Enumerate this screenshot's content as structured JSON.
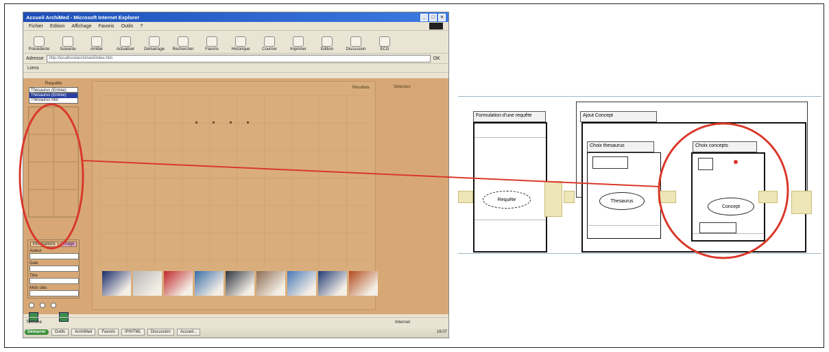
{
  "browser": {
    "title": "Accueil ArchiMed - Microsoft Internet Explorer",
    "window_controls": [
      "_",
      "□",
      "×"
    ],
    "menu": [
      "Fichier",
      "Edition",
      "Affichage",
      "Favoris",
      "Outils",
      "?"
    ],
    "toolbar": [
      "Précédente",
      "Suivante",
      "Arrêter",
      "Actualiser",
      "Démarrage",
      "Rechercher",
      "Favoris",
      "Historique",
      "Courrier",
      "Imprimer",
      "Édition",
      "Discussion",
      "ECG"
    ],
    "address_label": "Adresse",
    "address_value": "http://localhost/archimed/index.htm",
    "go_label": "OK",
    "links_label": "Liens",
    "status_left": "Terminé",
    "status_zone": "Internet"
  },
  "page": {
    "left_panel_title": "Requête",
    "combo_value": "Thésaurus (Entrée)",
    "combo_options": [
      "Thésaurus (Entrée)",
      "Thésaurus Mot"
    ],
    "info_tabs": [
      "Informations",
      "Image"
    ],
    "fields": [
      "Auteur",
      "Date",
      "Titre",
      "Mots clés"
    ],
    "main_label": "Résultats",
    "right_label": "Sélection",
    "thumb_colors": [
      "#1a2a6b",
      "#b7b7b7",
      "#c0262a",
      "#3a6ea8",
      "#2f3440",
      "#8d6d52",
      "#4a79b6",
      "#233b78",
      "#b14a1c"
    ]
  },
  "taskbar": {
    "start": "Démarrer",
    "tasks": [
      "Outils",
      "ArchiMed",
      "Favoris",
      "IP/HTML",
      "Discussion",
      "Accueil..."
    ],
    "clock": "16:07"
  },
  "diagram": {
    "modules": {
      "formulation": "Formulation d'une requête",
      "ajout": "Ajout Concept",
      "thesaurus_choice": "Choix thesaurus",
      "concept_choice": "Choix concepts"
    },
    "ellipses": {
      "requete": "Requête",
      "thesaurus": "Thesaurus",
      "concept": "Concept"
    }
  },
  "annotation_color": "#d9382a"
}
